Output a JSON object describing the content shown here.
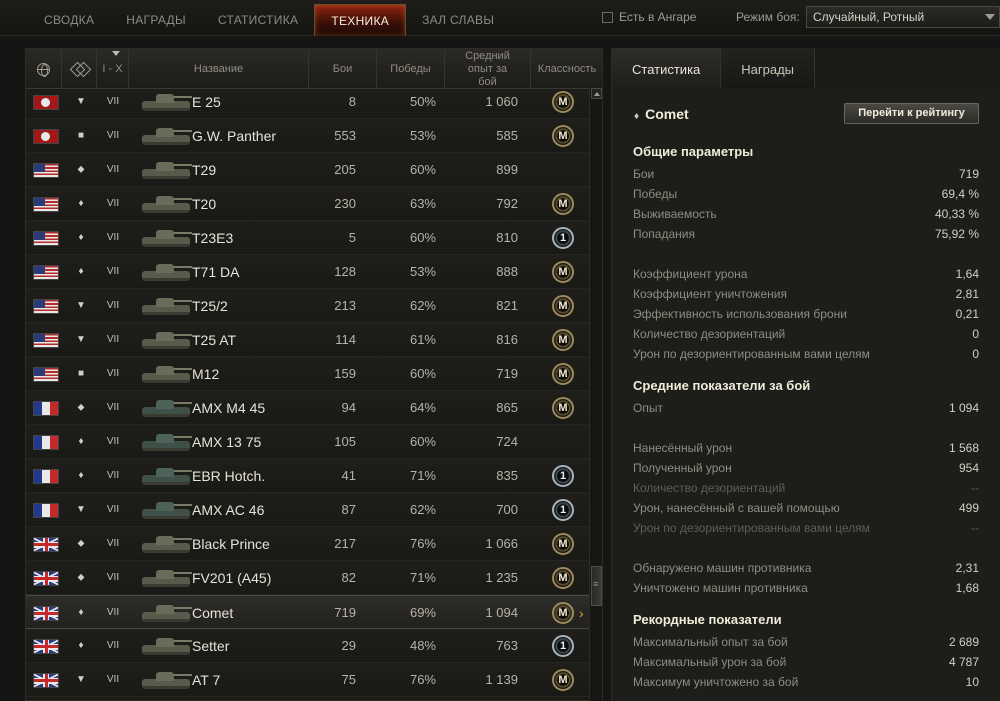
{
  "nav": {
    "tabs": [
      "СВОДКА",
      "НАГРАДЫ",
      "СТАТИСТИКА",
      "ТЕХНИКА",
      "ЗАЛ СЛАВЫ"
    ],
    "active_tab": 3,
    "hangar_label": "Есть в Ангаре",
    "mode_label": "Режим боя:",
    "mode_value": "Случайный, Ротный"
  },
  "table": {
    "headers": {
      "tier": "I - X",
      "name": "Название",
      "battles": "Бои",
      "wins": "Победы",
      "xp": "Средний опыт за бой",
      "class": "Классность"
    },
    "rows": [
      {
        "nation": "de",
        "type": "▼",
        "tier": "VII",
        "name": "E 25",
        "battles": "8",
        "wins": "50%",
        "xp": "1 060",
        "badge": "M",
        "badge_kind": "master"
      },
      {
        "nation": "de",
        "type": "■",
        "tier": "VII",
        "name": "G.W. Panther",
        "battles": "553",
        "wins": "53%",
        "xp": "585",
        "badge": "M",
        "badge_kind": "master"
      },
      {
        "nation": "us",
        "type": "⬥",
        "tier": "VII",
        "name": "T29",
        "battles": "205",
        "wins": "60%",
        "xp": "899",
        "badge": "",
        "badge_kind": ""
      },
      {
        "nation": "us",
        "type": "♦",
        "tier": "VII",
        "name": "T20",
        "battles": "230",
        "wins": "63%",
        "xp": "792",
        "badge": "M",
        "badge_kind": "master"
      },
      {
        "nation": "us",
        "type": "♦",
        "tier": "VII",
        "name": "T23E3",
        "battles": "5",
        "wins": "60%",
        "xp": "810",
        "badge": "1",
        "badge_kind": "first"
      },
      {
        "nation": "us",
        "type": "♦",
        "tier": "VII",
        "name": "T71 DA",
        "battles": "128",
        "wins": "53%",
        "xp": "888",
        "badge": "M",
        "badge_kind": "master"
      },
      {
        "nation": "us",
        "type": "▼",
        "tier": "VII",
        "name": "T25/2",
        "battles": "213",
        "wins": "62%",
        "xp": "821",
        "badge": "M",
        "badge_kind": "master"
      },
      {
        "nation": "us",
        "type": "▼",
        "tier": "VII",
        "name": "T25 AT",
        "battles": "114",
        "wins": "61%",
        "xp": "816",
        "badge": "M",
        "badge_kind": "master"
      },
      {
        "nation": "us",
        "type": "■",
        "tier": "VII",
        "name": "M12",
        "battles": "159",
        "wins": "60%",
        "xp": "719",
        "badge": "M",
        "badge_kind": "master"
      },
      {
        "nation": "fr",
        "type": "⬥",
        "tier": "VII",
        "name": "AMX M4 45",
        "battles": "94",
        "wins": "64%",
        "xp": "865",
        "badge": "M",
        "badge_kind": "master"
      },
      {
        "nation": "fr",
        "type": "♦",
        "tier": "VII",
        "name": "AMX 13 75",
        "battles": "105",
        "wins": "60%",
        "xp": "724",
        "badge": "",
        "badge_kind": ""
      },
      {
        "nation": "fr",
        "type": "♦",
        "tier": "VII",
        "name": "EBR Hotch.",
        "battles": "41",
        "wins": "71%",
        "xp": "835",
        "badge": "1",
        "badge_kind": "first"
      },
      {
        "nation": "fr",
        "type": "▼",
        "tier": "VII",
        "name": "AMX AC 46",
        "battles": "87",
        "wins": "62%",
        "xp": "700",
        "badge": "1",
        "badge_kind": "first"
      },
      {
        "nation": "uk",
        "type": "⬥",
        "tier": "VII",
        "name": "Black Prince",
        "battles": "217",
        "wins": "76%",
        "xp": "1 066",
        "badge": "M",
        "badge_kind": "master"
      },
      {
        "nation": "uk",
        "type": "⬥",
        "tier": "VII",
        "name": "FV201 (A45)",
        "battles": "82",
        "wins": "71%",
        "xp": "1 235",
        "badge": "M",
        "badge_kind": "master"
      },
      {
        "nation": "uk",
        "type": "♦",
        "tier": "VII",
        "name": "Comet",
        "battles": "719",
        "wins": "69%",
        "xp": "1 094",
        "badge": "M",
        "badge_kind": "master",
        "selected": true
      },
      {
        "nation": "uk",
        "type": "♦",
        "tier": "VII",
        "name": "Setter",
        "battles": "29",
        "wins": "48%",
        "xp": "763",
        "badge": "1",
        "badge_kind": "first"
      },
      {
        "nation": "uk",
        "type": "▼",
        "tier": "VII",
        "name": "AT 7",
        "battles": "75",
        "wins": "76%",
        "xp": "1 139",
        "badge": "M",
        "badge_kind": "master"
      }
    ]
  },
  "panel": {
    "tabs": [
      "Статистика",
      "Награды"
    ],
    "vehicle_name": "Comet",
    "rating_button": "Перейти к рейтингу",
    "general": {
      "title": "Общие параметры",
      "items": [
        {
          "label": "Бои",
          "value": "719"
        },
        {
          "label": "Победы",
          "value": "69,4 %"
        },
        {
          "label": "Выживаемость",
          "value": "40,33 %"
        },
        {
          "label": "Попадания",
          "value": "75,92 %"
        }
      ],
      "items2": [
        {
          "label": "Коэффициент урона",
          "value": "1,64"
        },
        {
          "label": "Коэффициент уничтожения",
          "value": "2,81"
        },
        {
          "label": "Эффективность использования брони",
          "value": "0,21"
        },
        {
          "label": "Количество дезориентаций",
          "value": "0"
        },
        {
          "label": "Урон по дезориентированным вами целям",
          "value": "0"
        }
      ]
    },
    "average": {
      "title": "Средние показатели за бой",
      "items": [
        {
          "label": "Опыт",
          "value": "1 094",
          "dim": false
        },
        {
          "label": "Нанесённый урон",
          "value": "1 568",
          "dim": false
        },
        {
          "label": "Полученный урон",
          "value": "954",
          "dim": false
        },
        {
          "label": "Количество дезориентаций",
          "value": "--",
          "dim": true
        },
        {
          "label": "Урон, нанесённый с вашей помощью",
          "value": "499",
          "dim": false
        },
        {
          "label": "Урон по дезориентированным вами целям",
          "value": "--",
          "dim": true
        },
        {
          "label": "Обнаружено машин противника",
          "value": "2,31",
          "dim": false
        },
        {
          "label": "Уничтожено машин противника",
          "value": "1,68",
          "dim": false
        }
      ]
    },
    "records": {
      "title": "Рекордные показатели",
      "items": [
        {
          "label": "Максимальный опыт за бой",
          "value": "2 689"
        },
        {
          "label": "Максимальный урон за бой",
          "value": "4 787"
        },
        {
          "label": "Максимум уничтожено за бой",
          "value": "10"
        }
      ]
    }
  }
}
